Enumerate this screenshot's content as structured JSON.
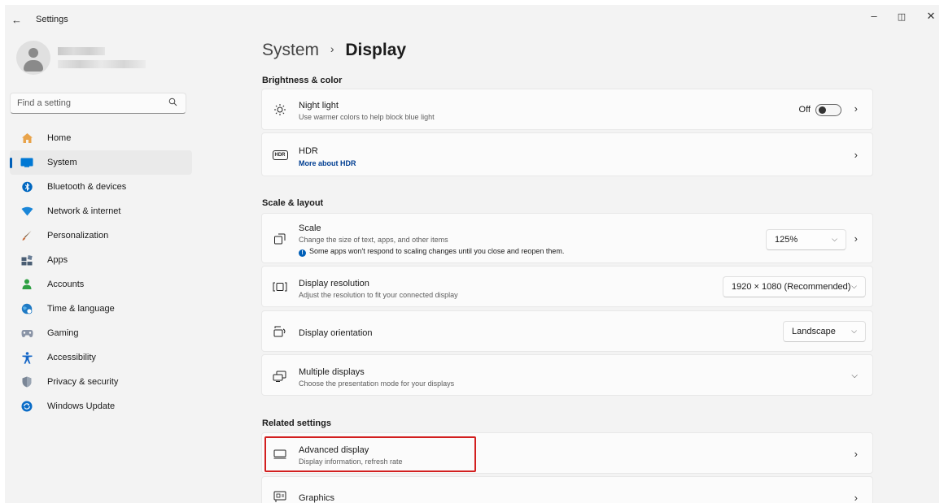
{
  "window": {
    "title": "Settings",
    "back_glyph": "←",
    "min_glyph": "–",
    "max_glyph": "◫",
    "close_glyph": "✕"
  },
  "search": {
    "placeholder": "Find a setting",
    "icon": "search-icon"
  },
  "nav": [
    {
      "label": "Home",
      "icon": "home-icon",
      "color": "#e8a34a",
      "active": false
    },
    {
      "label": "System",
      "icon": "system-icon",
      "color": "#0078d4",
      "active": true
    },
    {
      "label": "Bluetooth & devices",
      "icon": "bluetooth-icon",
      "color": "#0067c0",
      "active": false
    },
    {
      "label": "Network & internet",
      "icon": "network-icon",
      "color": "#1a86d8",
      "active": false
    },
    {
      "label": "Personalization",
      "icon": "brush-icon",
      "color": "#c86d3a",
      "active": false
    },
    {
      "label": "Apps",
      "icon": "apps-icon",
      "color": "#4a5d73",
      "active": false
    },
    {
      "label": "Accounts",
      "icon": "accounts-icon",
      "color": "#2ea043",
      "active": false
    },
    {
      "label": "Time & language",
      "icon": "globe-clock-icon",
      "color": "#1f7ac4",
      "active": false
    },
    {
      "label": "Gaming",
      "icon": "gamepad-icon",
      "color": "#8a94a6",
      "active": false
    },
    {
      "label": "Accessibility",
      "icon": "accessibility-icon",
      "color": "#1667c7",
      "active": false
    },
    {
      "label": "Privacy & security",
      "icon": "shield-icon",
      "color": "#7a8696",
      "active": false
    },
    {
      "label": "Windows Update",
      "icon": "update-icon",
      "color": "#0a6cc7",
      "active": false
    }
  ],
  "breadcrumb": {
    "parent": "System",
    "separator": "›",
    "current": "Display"
  },
  "sections": {
    "brightness": "Brightness & color",
    "scale_layout": "Scale & layout",
    "related": "Related settings"
  },
  "cards": {
    "night_light": {
      "title": "Night light",
      "subtitle": "Use warmer colors to help block blue light",
      "toggle_label": "Off",
      "toggle_on": false
    },
    "hdr": {
      "title": "HDR",
      "link": "More about HDR",
      "icon_text": "HDR"
    },
    "scale": {
      "title": "Scale",
      "subtitle": "Change the size of text, apps, and other items",
      "note": "Some apps won't respond to scaling changes until you close and reopen them.",
      "value": "125%"
    },
    "resolution": {
      "title": "Display resolution",
      "subtitle": "Adjust the resolution to fit your connected display",
      "value": "1920 × 1080 (Recommended)"
    },
    "orientation": {
      "title": "Display orientation",
      "value": "Landscape"
    },
    "multiple": {
      "title": "Multiple displays",
      "subtitle": "Choose the presentation mode for your displays"
    },
    "advanced": {
      "title": "Advanced display",
      "subtitle": "Display information, refresh rate"
    },
    "graphics": {
      "title": "Graphics"
    }
  },
  "colors": {
    "accent": "#005fb8",
    "highlight": "#d21f1f",
    "link": "#003e92"
  }
}
